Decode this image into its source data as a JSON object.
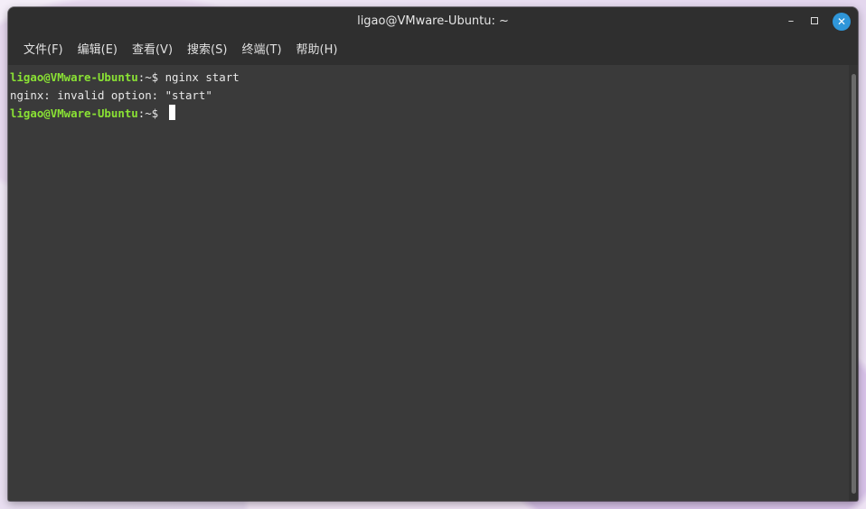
{
  "window": {
    "title": "ligao@VMware-Ubuntu: ~",
    "controls": {
      "minimize": "–",
      "maximize": "",
      "close": "✕"
    }
  },
  "menubar": {
    "items": [
      {
        "label": "文件(F)"
      },
      {
        "label": "编辑(E)"
      },
      {
        "label": "查看(V)"
      },
      {
        "label": "搜索(S)"
      },
      {
        "label": "终端(T)"
      },
      {
        "label": "帮助(H)"
      }
    ]
  },
  "terminal": {
    "lines": [
      {
        "user": "ligao@VMware-Ubuntu",
        "path": ":~$ ",
        "text": "nginx start"
      },
      {
        "text": "nginx: invalid option: \"start\""
      },
      {
        "user": "ligao@VMware-Ubuntu",
        "path": ":~$ ",
        "text": ""
      }
    ]
  },
  "colors": {
    "prompt_user": "#8ae234",
    "terminal_bg": "#3a3a3a",
    "titlebar_bg": "#2f2f2f",
    "close_button": "#2f96d9"
  }
}
